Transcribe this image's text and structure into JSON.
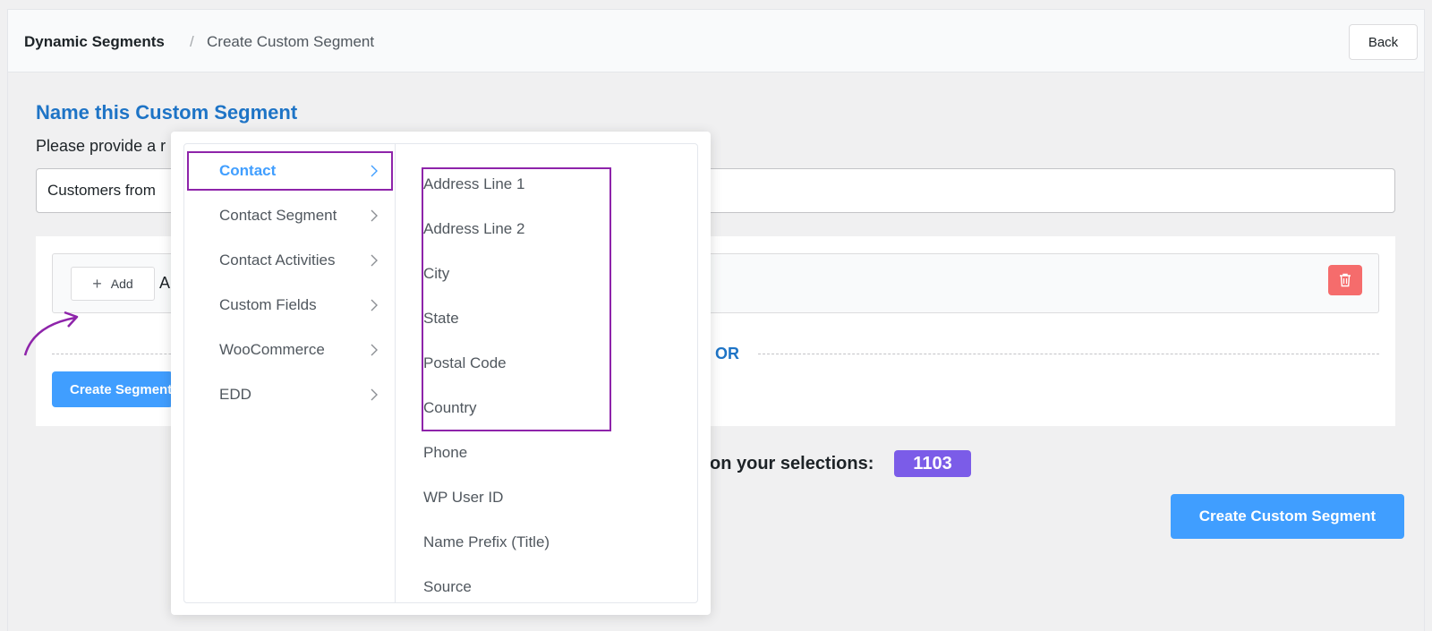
{
  "breadcrumb": {
    "root": "Dynamic Segments",
    "separator": "/",
    "current": "Create Custom Segment"
  },
  "header": {
    "back_label": "Back"
  },
  "name_section": {
    "title": "Name this Custom Segment",
    "description": "Please provide a r",
    "input_value": "Customers from"
  },
  "filter": {
    "add_label": "Add",
    "and_text": "A",
    "or_label": "OR",
    "create_segment_label": "Create Segment",
    "delete_icon": "trash-icon"
  },
  "estimate": {
    "text": "on your selections:",
    "count": "1103"
  },
  "footer": {
    "create_custom_segment_label": "Create Custom Segment"
  },
  "dropdown": {
    "categories": [
      {
        "label": "Contact",
        "active": true
      },
      {
        "label": "Contact Segment",
        "active": false
      },
      {
        "label": "Contact Activities",
        "active": false
      },
      {
        "label": "Custom Fields",
        "active": false
      },
      {
        "label": "WooCommerce",
        "active": false
      },
      {
        "label": "EDD",
        "active": false
      }
    ],
    "fields": [
      "Address Line 1",
      "Address Line 2",
      "City",
      "State",
      "Postal Code",
      "Country",
      "Phone",
      "WP User ID",
      "Name Prefix (Title)",
      "Source"
    ]
  },
  "colors": {
    "accent": "#409eff",
    "title_blue": "#1e74c6",
    "highlight": "#8e24aa",
    "badge": "#7b5ce8",
    "danger": "#f56c6c"
  }
}
